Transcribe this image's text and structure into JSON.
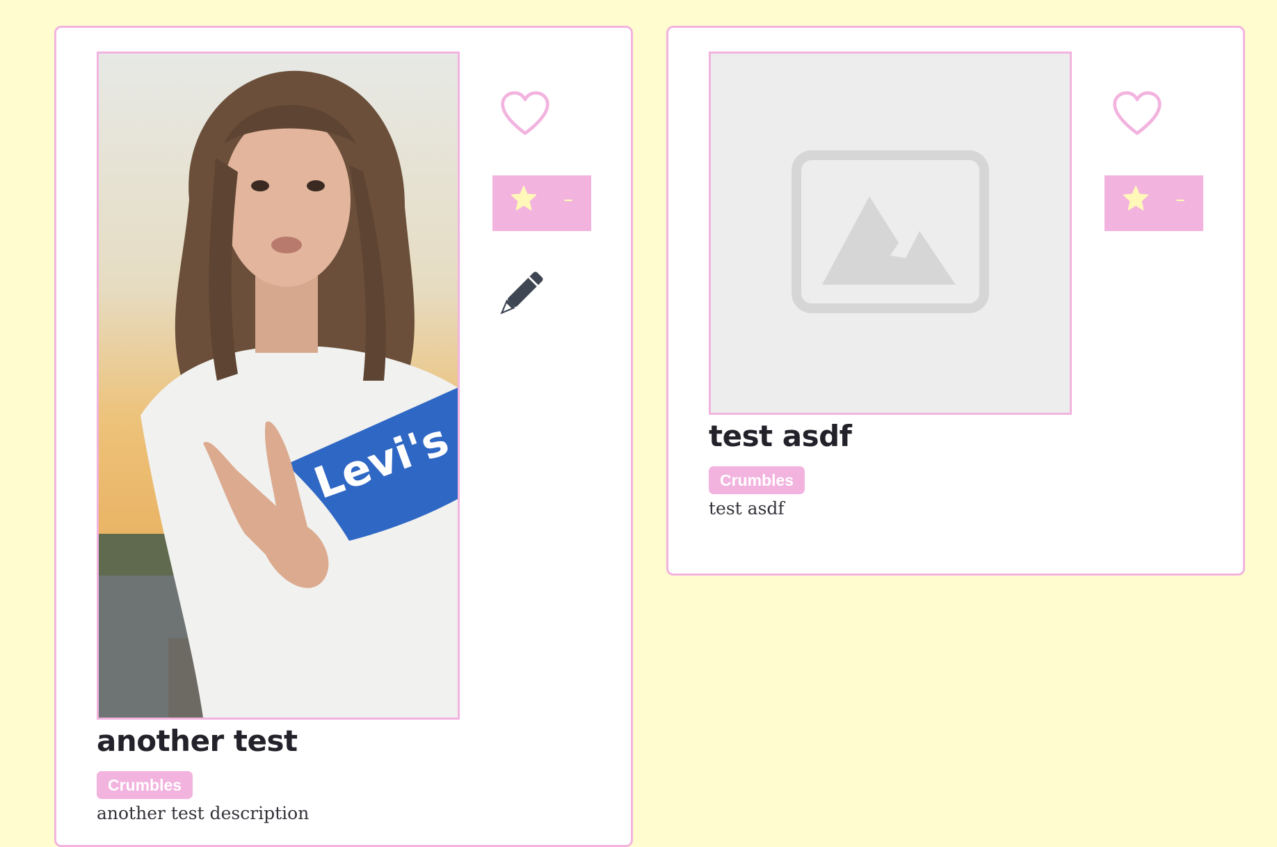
{
  "colors": {
    "page_background": "#fffdcf",
    "card_background": "#ffffff",
    "accent_pink": "#f2b3df",
    "star_yellow": "#fff8b8",
    "pencil_dark": "#3e4653",
    "title_text": "#23222a"
  },
  "cards": [
    {
      "image": "photo",
      "title": "another test",
      "tag": "Crumbles",
      "description": "another test description",
      "rating": "–",
      "icons": [
        "heart-outline-icon",
        "star-icon",
        "pencil-icon"
      ]
    },
    {
      "image": "image-placeholder",
      "title": "test asdf",
      "tag": "Crumbles",
      "description": "test asdf",
      "rating": "–",
      "icons": [
        "heart-outline-icon",
        "star-icon"
      ]
    }
  ]
}
